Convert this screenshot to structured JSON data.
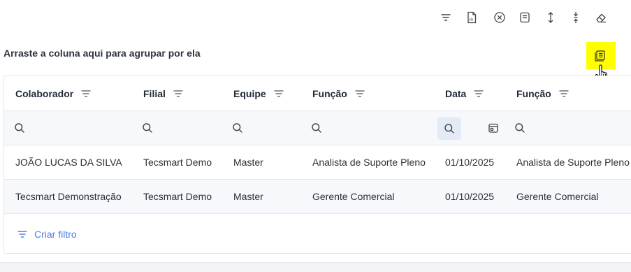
{
  "toolbar": {
    "icons": [
      "filter-lines-icon",
      "export-xls-icon",
      "clear-circle-icon",
      "notes-icon",
      "expand-vertical-icon",
      "collapse-vertical-icon",
      "eraser-icon"
    ]
  },
  "group_panel": {
    "text": "Arraste a coluna aqui para agrupar por ela"
  },
  "grid": {
    "columns": [
      {
        "label": "Colaborador"
      },
      {
        "label": "Filial"
      },
      {
        "label": "Equipe"
      },
      {
        "label": "Função"
      },
      {
        "label": "Data"
      },
      {
        "label": "Função"
      }
    ],
    "rows": [
      [
        "JOÃO LUCAS DA SILVA",
        "Tecsmart Demo",
        "Master",
        "Analista de Suporte Pleno",
        "01/10/2025",
        "Analista de Suporte Pleno"
      ],
      [
        "Tecsmart Demonstração",
        "Tecsmart Demo",
        "Master",
        "Gerente Comercial",
        "01/10/2025",
        "Gerente Comercial"
      ]
    ],
    "footer": {
      "create_filter_label": "Criar filtro"
    }
  },
  "colors": {
    "highlight": "#ffff00",
    "link": "#4f7ee8",
    "active_search_bg": "#e4ebf7",
    "striped_row": "#f6f8fb"
  }
}
